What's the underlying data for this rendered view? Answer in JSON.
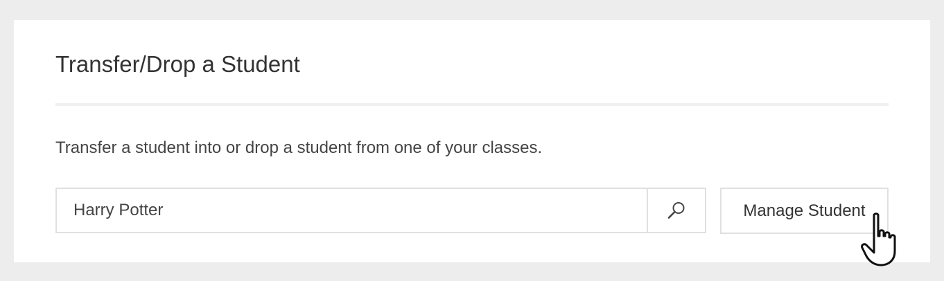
{
  "panel": {
    "title": "Transfer/Drop a Student",
    "description": "Transfer a student into or drop a student from one of your classes."
  },
  "search": {
    "value": "Harry Potter",
    "button_icon": "search-icon"
  },
  "actions": {
    "manage_label": "Manage Student"
  },
  "cursor": {
    "icon": "hand-pointer-icon"
  },
  "colors": {
    "page_background": "#ededed",
    "card_background": "#ffffff",
    "border": "#e0e0e0",
    "text": "#333333"
  }
}
